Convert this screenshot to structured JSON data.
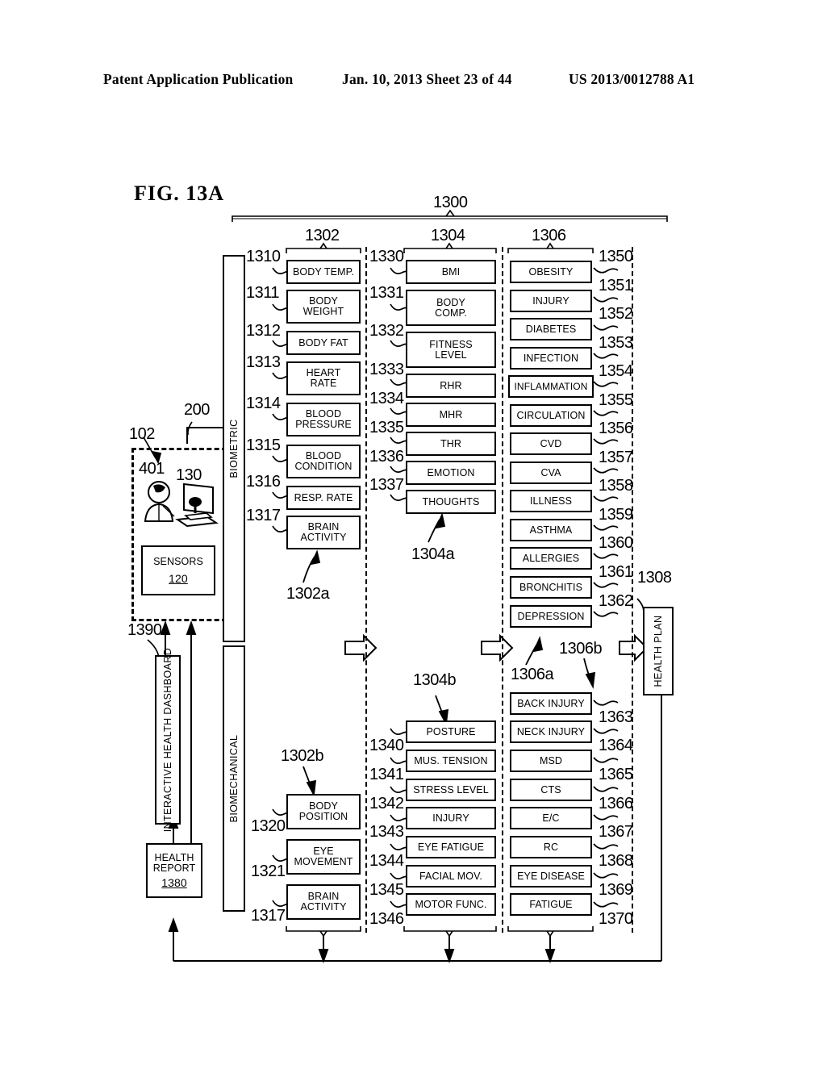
{
  "header": {
    "publication": "Patent Application Publication",
    "date_sheet": "Jan. 10, 2013  Sheet 23 of 44",
    "patent_number": "US 2013/0012788 A1"
  },
  "figure": {
    "label": "FIG. 13A",
    "system_ref": "1300"
  },
  "stage_refs": {
    "stage1": "1302",
    "stage2": "1304",
    "stage3": "1306",
    "output": "1308"
  },
  "group_refs": {
    "biometric_upper": "1302a",
    "biomechanical_lower": "1302b",
    "stage2_upper": "1304a",
    "stage2_lower": "1304b",
    "stage3_upper": "1306a",
    "stage3_lower": "1306b"
  },
  "category_bars": [
    {
      "label": "BIOMETRIC"
    },
    {
      "label": "BIOMECHANICAL"
    }
  ],
  "user_block": {
    "ref_user_env": "102",
    "ref_feed": "200",
    "ref_person": "401",
    "ref_computer": "130",
    "sensors_label": "SENSORS",
    "sensors_ref": "120"
  },
  "dashboard": {
    "label": "INTERACTIVE HEALTH DASHBOARD",
    "ref": "1390"
  },
  "health_report": {
    "line1": "HEALTH",
    "line2": "REPORT",
    "ref": "1380"
  },
  "health_plan": {
    "label": "HEALTH PLAN",
    "ref": "1308"
  },
  "columns": {
    "biometric_inputs": {
      "items": [
        {
          "ref": "1310",
          "label": "BODY TEMP."
        },
        {
          "ref": "1311",
          "label": "BODY\nWEIGHT"
        },
        {
          "ref": "1312",
          "label": "BODY FAT"
        },
        {
          "ref": "1313",
          "label": "HEART\nRATE"
        },
        {
          "ref": "1314",
          "label": "BLOOD\nPRESSURE"
        },
        {
          "ref": "1315",
          "label": "BLOOD\nCONDITION"
        },
        {
          "ref": "1316",
          "label": "RESP. RATE"
        },
        {
          "ref": "1317",
          "label": "BRAIN\nACTIVITY"
        }
      ]
    },
    "derived_metrics": {
      "items": [
        {
          "ref": "1330",
          "label": "BMI"
        },
        {
          "ref": "1331",
          "label": "BODY\nCOMP."
        },
        {
          "ref": "1332",
          "label": "FITNESS\nLEVEL"
        },
        {
          "ref": "1333",
          "label": "RHR"
        },
        {
          "ref": "1334",
          "label": "MHR"
        },
        {
          "ref": "1335",
          "label": "THR"
        },
        {
          "ref": "1336",
          "label": "EMOTION"
        },
        {
          "ref": "1337",
          "label": "THOUGHTS"
        }
      ]
    },
    "conditions": {
      "items": [
        {
          "ref": "1350",
          "label": "OBESITY"
        },
        {
          "ref": "1351",
          "label": "INJURY"
        },
        {
          "ref": "1352",
          "label": "DIABETES"
        },
        {
          "ref": "1353",
          "label": "INFECTION"
        },
        {
          "ref": "1354",
          "label": "INFLAMMATION"
        },
        {
          "ref": "1355",
          "label": "CIRCULATION"
        },
        {
          "ref": "1356",
          "label": "CVD"
        },
        {
          "ref": "1357",
          "label": "CVA"
        },
        {
          "ref": "1358",
          "label": "ILLNESS"
        },
        {
          "ref": "1359",
          "label": "ASTHMA"
        },
        {
          "ref": "1360",
          "label": "ALLERGIES"
        },
        {
          "ref": "1361",
          "label": "BRONCHITIS"
        },
        {
          "ref": "1362",
          "label": "DEPRESSION"
        }
      ]
    },
    "biomechanical_inputs": {
      "items": [
        {
          "ref": "1320",
          "label": "BODY\nPOSITION"
        },
        {
          "ref": "1321",
          "label": "EYE\nMOVEMENT"
        },
        {
          "ref": "1317",
          "label": "BRAIN\nACTIVITY"
        }
      ]
    },
    "biomechanical_metrics": {
      "items": [
        {
          "ref": "1340",
          "label": "POSTURE"
        },
        {
          "ref": "1341",
          "label": "MUS. TENSION"
        },
        {
          "ref": "1342",
          "label": "STRESS LEVEL"
        },
        {
          "ref": "1343",
          "label": "INJURY"
        },
        {
          "ref": "1344",
          "label": "EYE FATIGUE"
        },
        {
          "ref": "1345",
          "label": "FACIAL MOV."
        },
        {
          "ref": "1346",
          "label": "MOTOR FUNC."
        }
      ]
    },
    "biomechanical_conditions": {
      "items": [
        {
          "ref": "1363",
          "label": "BACK INJURY"
        },
        {
          "ref": "1364",
          "label": "NECK INJURY"
        },
        {
          "ref": "1365",
          "label": "MSD"
        },
        {
          "ref": "1366",
          "label": "CTS"
        },
        {
          "ref": "1367",
          "label": "E/C"
        },
        {
          "ref": "1368",
          "label": "RC"
        },
        {
          "ref": "1369",
          "label": "EYE DISEASE"
        },
        {
          "ref": "1370",
          "label": "FATIGUE"
        }
      ]
    }
  }
}
